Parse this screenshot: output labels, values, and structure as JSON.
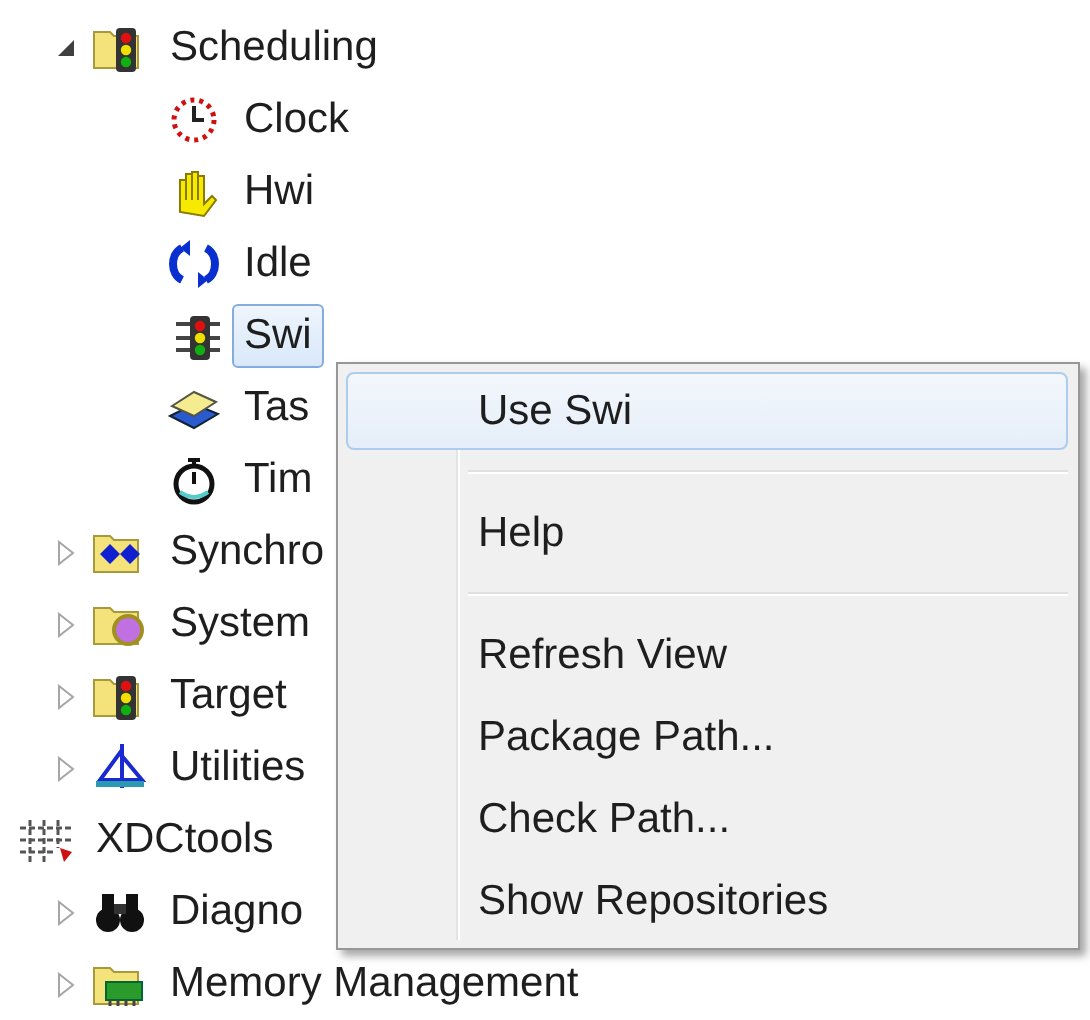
{
  "tree": [
    {
      "children": [
        {
          "label": "Scheduling",
          "expanded": true,
          "selected": false,
          "children": [
            {
              "label": "Clock",
              "selected": false
            },
            {
              "label": "Hwi",
              "selected": false
            },
            {
              "label": "Idle",
              "selected": false
            },
            {
              "label": "Swi",
              "selected": true
            },
            {
              "label": "Tas",
              "selected": false
            },
            {
              "label": "Tim",
              "selected": false
            }
          ]
        },
        {
          "label": "Synchro",
          "expanded": false,
          "selected": false
        },
        {
          "label": "System",
          "expanded": false,
          "selected": false
        },
        {
          "label": "Target",
          "expanded": false,
          "selected": false
        },
        {
          "label": "Utilities",
          "expanded": false,
          "selected": false
        }
      ]
    },
    {
      "label": "XDCtools",
      "selected": false,
      "children": [
        {
          "label": "Diagno",
          "expanded": false,
          "selected": false
        },
        {
          "label": "Memory Management",
          "expanded": false,
          "selected": false
        }
      ]
    }
  ],
  "context_menu": {
    "items": [
      {
        "kind": "item",
        "label": "Use Swi",
        "selected": true
      },
      {
        "kind": "separator"
      },
      {
        "kind": "item",
        "label": "Help",
        "selected": false
      },
      {
        "kind": "separator"
      },
      {
        "kind": "item",
        "label": "Refresh View",
        "selected": false
      },
      {
        "kind": "item",
        "label": "Package Path...",
        "selected": false
      },
      {
        "kind": "item",
        "label": "Check Path...",
        "selected": false
      },
      {
        "kind": "item",
        "label": "Show Repositories",
        "selected": false
      }
    ]
  }
}
